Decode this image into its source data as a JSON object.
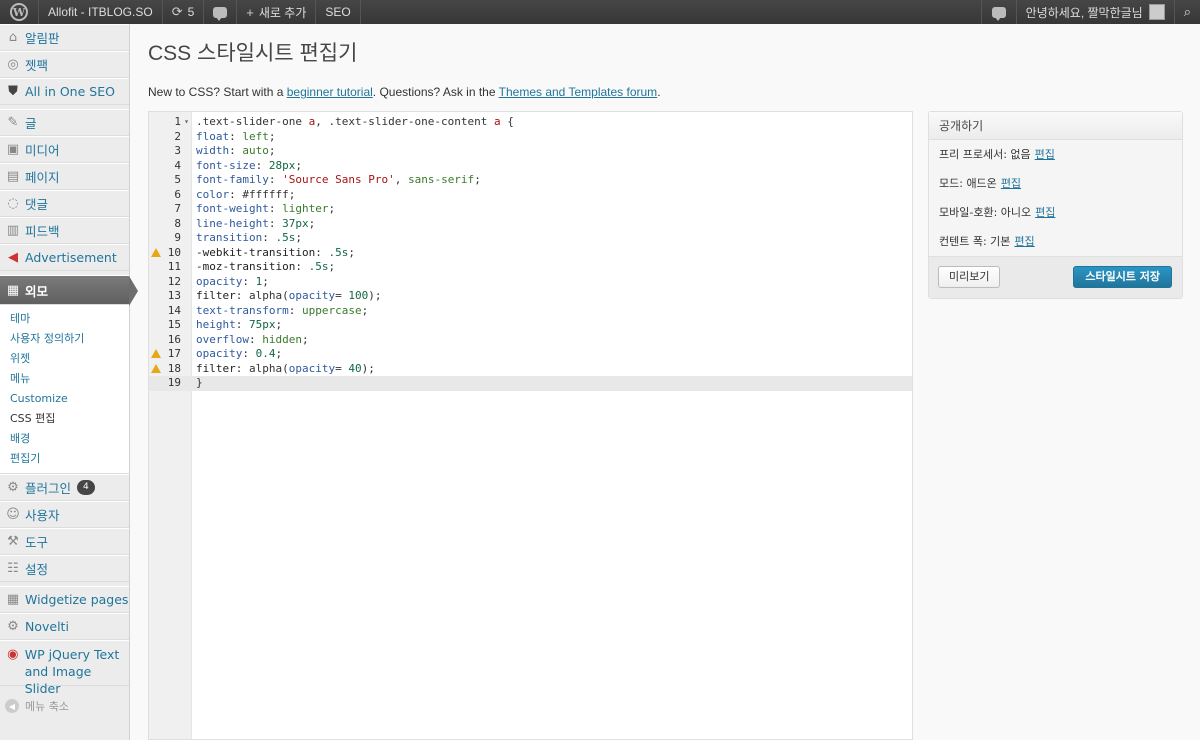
{
  "adminbar": {
    "site_name": "Allofit - ITBLOG.SO",
    "updates_count": "5",
    "new_label": "새로 추가",
    "seo_label": "SEO",
    "greeting": "안녕하세요, 짤막한글님"
  },
  "sidebar": {
    "dashboard": "알림판",
    "jetpack": "젯팩",
    "aioseo": "All in One SEO",
    "posts": "글",
    "media": "미디어",
    "pages": "페이지",
    "comments": "댓글",
    "feedback": "피드백",
    "advertisement": "Advertisement",
    "appearance": "외모",
    "appearance_sub": [
      "테마",
      "사용자 정의하기",
      "위젯",
      "메뉴",
      "Customize",
      "CSS 편집",
      "배경",
      "편집기"
    ],
    "plugins": "플러그인",
    "plugins_badge": "4",
    "users": "사용자",
    "tools": "도구",
    "settings": "설정",
    "widgetize": "Widgetize pages",
    "novelti": "Novelti",
    "wp_jquery_line1": "WP jQuery Text",
    "wp_jquery_line2": "and Image Slider",
    "collapse": "메뉴 축소"
  },
  "page": {
    "title": "CSS 스타일시트 편집기",
    "intro_prefix": "New to CSS? Start with a ",
    "intro_link1": "beginner tutorial",
    "intro_mid": ". Questions? Ask in the ",
    "intro_link2": "Themes and Templates forum",
    "intro_suffix": "."
  },
  "editor": {
    "lines": [
      ".text-slider-one a, .text-slider-one-content a {",
      "float: left;",
      "width: auto;",
      "font-size: 28px;",
      "font-family: 'Source Sans Pro', sans-serif;",
      "color: #ffffff;",
      "font-weight: lighter;",
      "line-height: 37px;",
      "transition: .5s;",
      "-webkit-transition: .5s;",
      "-moz-transition: .5s;",
      "opacity: 1;",
      "filter: alpha(opacity= 100);",
      "text-transform: uppercase;",
      "height: 75px;",
      "overflow: hidden;",
      "opacity: 0.4;",
      "filter: alpha(opacity= 40);",
      "}"
    ],
    "warning_lines": [
      10,
      17,
      18
    ],
    "active_line": 19,
    "colors": {
      "property": "#2f5a9e",
      "value": "#3a7a2a",
      "number": "#116644",
      "string": "#aa1111",
      "warning": "#e6a817"
    }
  },
  "publish": {
    "title": "공개하기",
    "preprocessor_label": "프리 프로세서: 없음",
    "mode_label": "모드: 애드온",
    "mobile_label": "모바일-호환: 아니오",
    "content_width_label": "컨텐트 폭: 기본",
    "edit_link": "편집",
    "preview_button": "미리보기",
    "save_button": "스타일시트 저장"
  }
}
